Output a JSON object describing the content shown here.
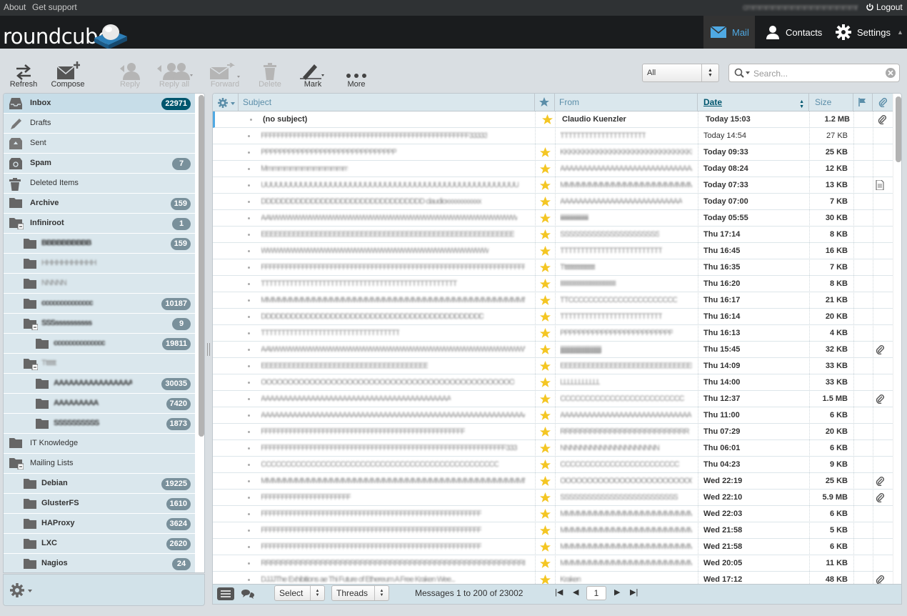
{
  "topbar": {
    "about": "About",
    "support": "Get support",
    "user": "cmmmmmmmmmmmmmmmmmmmmmmmmmmmmmmmmmm",
    "logout": "Logout"
  },
  "header": {
    "logo": "roundcube",
    "tabs": {
      "mail": "Mail",
      "contacts": "Contacts",
      "settings": "Settings"
    }
  },
  "toolbar": {
    "refresh": "Refresh",
    "compose": "Compose",
    "reply": "Reply",
    "reply_all": "Reply all",
    "forward": "Forward",
    "delete": "Delete",
    "mark": "Mark",
    "more": "More"
  },
  "filter": {
    "selected": "All"
  },
  "search": {
    "placeholder": "Search..."
  },
  "folders": [
    {
      "name": "Inbox",
      "count": "22971",
      "bold": true,
      "selected": true,
      "icon": "inbox-icon",
      "level": 0
    },
    {
      "name": "Drafts",
      "count": "",
      "bold": false,
      "icon": "pencil-icon",
      "level": 0
    },
    {
      "name": "Sent",
      "count": "",
      "bold": false,
      "icon": "sent-icon",
      "level": 0
    },
    {
      "name": "Spam",
      "count": "7",
      "bold": true,
      "icon": "spam-icon",
      "level": 0
    },
    {
      "name": "Deleted Items",
      "count": "",
      "bold": false,
      "icon": "trash-icon",
      "level": 0
    },
    {
      "name": "Archive",
      "count": "159",
      "bold": true,
      "icon": "folder-icon",
      "level": 0
    },
    {
      "name": "Infiniroot",
      "count": "1",
      "bold": true,
      "icon": "folder-collapse-icon",
      "level": 0
    },
    {
      "name": "BBBBBBBBBB",
      "count": "159",
      "bold": true,
      "icon": "folder-icon",
      "level": 1,
      "blur": true
    },
    {
      "name": "HHHHHHHHHHH",
      "count": "",
      "bold": false,
      "icon": "folder-icon",
      "level": 1,
      "blur": true
    },
    {
      "name": "NNNNN",
      "count": "",
      "bold": false,
      "icon": "folder-icon",
      "level": 1,
      "blur": true
    },
    {
      "name": "cccccccccccccc",
      "count": "10187",
      "bold": true,
      "icon": "folder-icon",
      "level": 1,
      "blur": true
    },
    {
      "name": "SSSssssssssss",
      "count": "9",
      "bold": true,
      "icon": "folder-collapse-icon",
      "level": 1,
      "blur": true
    },
    {
      "name": "cccccccccccccc",
      "count": "19811",
      "bold": true,
      "icon": "folder-icon",
      "level": 2,
      "blur": true
    },
    {
      "name": "Tttttttt",
      "count": "",
      "bold": false,
      "icon": "folder-collapse-icon",
      "level": 1,
      "blur": true
    },
    {
      "name": "AAAAAAAAAAAAAAAAAA",
      "count": "30035",
      "bold": true,
      "icon": "folder-icon",
      "level": 2,
      "blur": true
    },
    {
      "name": "AAAAAAAAA",
      "count": "7420",
      "bold": true,
      "icon": "folder-icon",
      "level": 2,
      "blur": true
    },
    {
      "name": "SSSSSSSSSS",
      "count": "1873",
      "bold": true,
      "icon": "folder-icon",
      "level": 2,
      "blur": true
    },
    {
      "name": "IT Knowledge",
      "count": "",
      "bold": false,
      "icon": "folder-icon",
      "level": 0
    },
    {
      "name": "Mailing Lists",
      "count": "",
      "bold": false,
      "icon": "folder-collapse-icon",
      "level": 0
    },
    {
      "name": "Debian",
      "count": "19225",
      "bold": true,
      "icon": "folder-icon",
      "level": 1
    },
    {
      "name": "GlusterFS",
      "count": "1610",
      "bold": true,
      "icon": "folder-icon",
      "level": 1
    },
    {
      "name": "HAProxy",
      "count": "3624",
      "bold": true,
      "icon": "folder-icon",
      "level": 1
    },
    {
      "name": "LXC",
      "count": "2620",
      "bold": true,
      "icon": "folder-icon",
      "level": 1
    },
    {
      "name": "Nagios",
      "count": "24",
      "bold": true,
      "icon": "folder-icon",
      "level": 1
    }
  ],
  "list_header": {
    "subject": "Subject",
    "from": "From",
    "date": "Date",
    "size": "Size"
  },
  "messages": [
    {
      "subject": "(no subject)",
      "from": "Claudio Kuenzler",
      "date": "Today 15:03",
      "size": "1.2 MB",
      "unread": true,
      "star": true,
      "att": "clip"
    },
    {
      "subject": "FFFFFFFFFFFFFFFFFFFFFFFFFFFFFFFFFFFFFFFFFFFFFFFFFFF33333",
      "from": "TTTTTTTTTTTTTTTTTTTTT",
      "date": "Today 14:54",
      "size": "27 KB",
      "unread": false,
      "star": false,
      "att": ""
    },
    {
      "subject": "PPPPPPPPPPPPPPPPPPPPPPPPPPPPPP",
      "from": "KKKKKKKKKKKKKKKKKKKKKKKKKKKKKK",
      "date": "Today 09:33",
      "size": "25 KB",
      "unread": true,
      "star": true,
      "att": ""
    },
    {
      "subject": "Mmmmmmmmmmmmmmm",
      "from": "AAAAAAAAAAAAAAAAAAAAAAAAAAAAAAA",
      "date": "Today 08:24",
      "size": "12 KB",
      "unread": true,
      "star": true,
      "att": ""
    },
    {
      "subject": "UUUUUUUUUUUUUUUUUUUUUUUUUUUUUUUUUUUUUUUUUUUUUUUUUUUU",
      "from": "MMMMMMMMMMMMMMMMMMMMMMMMMMMMMMMMMMMMMMMM...",
      "date": "Today 07:33",
      "size": "13 KB",
      "unread": true,
      "star": true,
      "att": "doc"
    },
    {
      "subject": "DDDDDDDDDDDDDDDDDDDDDDDDDDDDDDDDD claudioxxxxxxxxxxx",
      "from": "AAAAAAAAAAAAAAAAAAAAAAAAAAA",
      "date": "Today 07:00",
      "size": "7 KB",
      "unread": true,
      "star": true,
      "att": ""
    },
    {
      "subject": "AAWWWWWWWWWWWWWWWWWWWWWWWWWWWWWWWWWWWWW",
      "from": "iiiiiiiiiiiiiiiiiiiiiiiiiiii",
      "date": "Today 05:55",
      "size": "30 KB",
      "unread": true,
      "star": true,
      "att": ""
    },
    {
      "subject": "EEEEEEEEEEEEEEEEEEEEEEEEEEEEEEEEEEEEEEEEEEEEEEEEEEEEEEEE",
      "from": "SSSSSSSSSSSSSSSSSSSSSS",
      "date": "Thu 17:14",
      "size": "8 KB",
      "unread": true,
      "star": true,
      "att": ""
    },
    {
      "subject": "WWWWWWWWWWWWWWWWWWWWWWWWWWWWWWWWWW",
      "from": "TTTTTTTTTTTTTTTTTTTTTTTTT",
      "date": "Thu 16:45",
      "size": "16 KB",
      "unread": true,
      "star": true,
      "att": ""
    },
    {
      "subject": "FFFFFFFFFFFFFFFFFFFFFFFFFFFFFFFFFFFFFFFFFFFFFFFFFFFFFFFFFFFFFFFFFFFFFFFFFds",
      "from": "Tttttttttttttttttttttt",
      "date": "Thu 16:35",
      "size": "7 KB",
      "unread": true,
      "star": true,
      "att": ""
    },
    {
      "subject": "TTTTTTTTTTTTTTTTTTTTTTTTTTTTTTTTTTTTTTTTTTTTTTTT",
      "from": "IIIIIIIIIIIIIIIIIIIIIIIIIIIIIIIIIIIIII",
      "date": "Thu 16:20",
      "size": "8 KB",
      "unread": true,
      "star": true,
      "att": ""
    },
    {
      "subject": "MMMMMMMMMMMMMMMMMMMMMMMMMMMMMMMMMMMMMMMMMMMMMMMMMMMM333",
      "from": "TTCCCCCCCCCCCCCCCCCCCCCC",
      "date": "Thu 16:17",
      "size": "21 KB",
      "unread": true,
      "star": true,
      "att": ""
    },
    {
      "subject": "DDDDDDDDDDDDDDDDDDDDDDDDDDDDDDDDDDDDDDDDDDDDD",
      "from": "TTTTTTTTTTTTTTTTTTTTTTTTT",
      "date": "Thu 16:14",
      "size": "20 KB",
      "unread": true,
      "star": true,
      "att": ""
    },
    {
      "subject": "TTTTTTTTTTTTTTTTTTTTTTTTTTTTTTTTTT",
      "from": "PPPPPPPPPPPPPPPPPPPPPPPPP",
      "date": "Thu 16:13",
      "size": "4 KB",
      "unread": true,
      "star": true,
      "att": ""
    },
    {
      "subject": "AAWWWWWWWWWWWWWWWWWWWWWWWWWWWWWWWWWWWWWWWWWWWWWWWWW",
      "from": "jjjjjjjjjjjjjjjjjjjjjjjjjjjjjjjjjjjjjjjj",
      "date": "Thu 15:45",
      "size": "32 KB",
      "unread": true,
      "star": true,
      "att": "clip"
    },
    {
      "subject": "EEEEEEEEEEEEEEEEEEEEEEEEEEEEEEEEEEEEE",
      "from": "EEEEEEEEEEEEEEEEEEEEEEEEEEEEEEEEEEEEE",
      "date": "Thu 14:09",
      "size": "33 KB",
      "unread": true,
      "star": true,
      "att": ""
    },
    {
      "subject": "OOOOOOOOOOOOOOOOOOOOOOOOOOOOOOOOOOOOOOOOOOOOOOO",
      "from": "LLLLLLLLLLL",
      "date": "Thu 14:00",
      "size": "33 KB",
      "unread": true,
      "star": true,
      "att": ""
    },
    {
      "subject": "AAAAAAAAAAAAAAAAAAAAAAAAAAAAAAAAAAAAAAAAAA",
      "from": "CCCCCCCCCCCCCCCCCCCCCCCCC",
      "date": "Thu 12:37",
      "size": "1.5 MB",
      "unread": true,
      "star": true,
      "att": "clip"
    },
    {
      "subject": "AAAAAAAAAAAAAAAAAAAAAAAAAAAAAAAAAAAAAAAAAAAAAAAAAAAAAAAAAAAAAAAAAAAAA3D",
      "from": "AAAAAAAAAAAAAAAAAAAAAAAAAAAAA",
      "date": "Thu 11:00",
      "size": "6 KB",
      "unread": true,
      "star": true,
      "att": ""
    },
    {
      "subject": "FFFFFFFFFFFFFFFFFFFFFFFFFFFFFFFFFFFFFFFFFFFFFFFFFF",
      "from": "RRRRRRRRRRRRRRRRRRRRRRRRRR",
      "date": "Thu 07:29",
      "size": "20 KB",
      "unread": true,
      "star": true,
      "att": ""
    },
    {
      "subject": "FFFFFFFFFFFFFFFFFFFFFFFFFFFFFFFFFFFFFFFFFFFFFFFFFFFFFFFFFFFF333",
      "from": "NNNNNNNNNNNNNNNNNNNN",
      "date": "Thu 06:01",
      "size": "6 KB",
      "unread": true,
      "star": true,
      "att": ""
    },
    {
      "subject": "CCCCCCCCCCCCCCCCCCCCCCCCCCCCCCCCCCCCCCCCCCCCCCCC",
      "from": "CCCCCCCCCCCCCCCCCCCCCCCC",
      "date": "Thu 04:23",
      "size": "9 KB",
      "unread": true,
      "star": true,
      "att": ""
    },
    {
      "subject": "MMMMMMMMMMMMMMMMMMMMMMMMMMMMMMMMMMMMMMMMMMMMMMMMMMMMMMMMMMMMMMM",
      "from": "OOOOOOOOOOOOOOOOOOOOOOOOO",
      "date": "Wed 22:19",
      "size": "25 KB",
      "unread": true,
      "star": true,
      "att": "clip"
    },
    {
      "subject": "FFFFFFFFFFFFFFFFFFFFFF",
      "from": "SSSSSSSSSSSSSSSSSSSSSSSSSS",
      "date": "Wed 22:10",
      "size": "5.9 MB",
      "unread": true,
      "star": true,
      "att": "clip"
    },
    {
      "subject": "FFFFFFFFFFFFFFFFFFFFFFFFFFFFFFFFFFFFFFFFFFFFFFFFFFFFFF",
      "from": "MMMMMMMMMMMMMMMMMMMMMMMMM",
      "date": "Wed 22:03",
      "size": "6 KB",
      "unread": true,
      "star": true,
      "att": ""
    },
    {
      "subject": "FFFFFFFFFFFFFFFFFFFFFFFFFFFFFFFFFFFFFFFFFFFFFFFFFFFFFF",
      "from": "MMMMMMMMMMMMMMMMMMMMMMMMM",
      "date": "Wed 21:58",
      "size": "5 KB",
      "unread": true,
      "star": true,
      "att": ""
    },
    {
      "subject": "FFFFFFFFFFFFFFFFFFFFFFFFFFFFFFFFFFFFFFFFFFFFFFFFFFFFFF",
      "from": "MMMMMMMMMMMMMMMMMMMMMMMMM",
      "date": "Wed 21:58",
      "size": "6 KB",
      "unread": true,
      "star": true,
      "att": ""
    },
    {
      "subject": "RRRRRRRRRRRRRRRRRRRRRRRRRRRRRRRRRRRRRRRRRRRRRRRRRRRRRR333",
      "from": "MMMMMMMMMMMMMMMMMMMMMMMMMMMMMM",
      "date": "Wed 20:05",
      "size": "11 KB",
      "unread": true,
      "star": true,
      "att": ""
    },
    {
      "subject": "DJJJThe Exhibitions ae Thi Future of Ethereum A Free Kraken Wee...",
      "from": "Kraken",
      "date": "Wed 17:12",
      "size": "48 KB",
      "unread": true,
      "star": true,
      "att": "clip"
    }
  ],
  "footer": {
    "select": "Select",
    "threads": "Threads",
    "count_text": "Messages 1 to 200 of 23002",
    "page": "1"
  },
  "colors": {
    "accent": "#4fa9e3",
    "star": "#f4c623",
    "badge": "#79909b",
    "badge_selected": "#00566e"
  }
}
